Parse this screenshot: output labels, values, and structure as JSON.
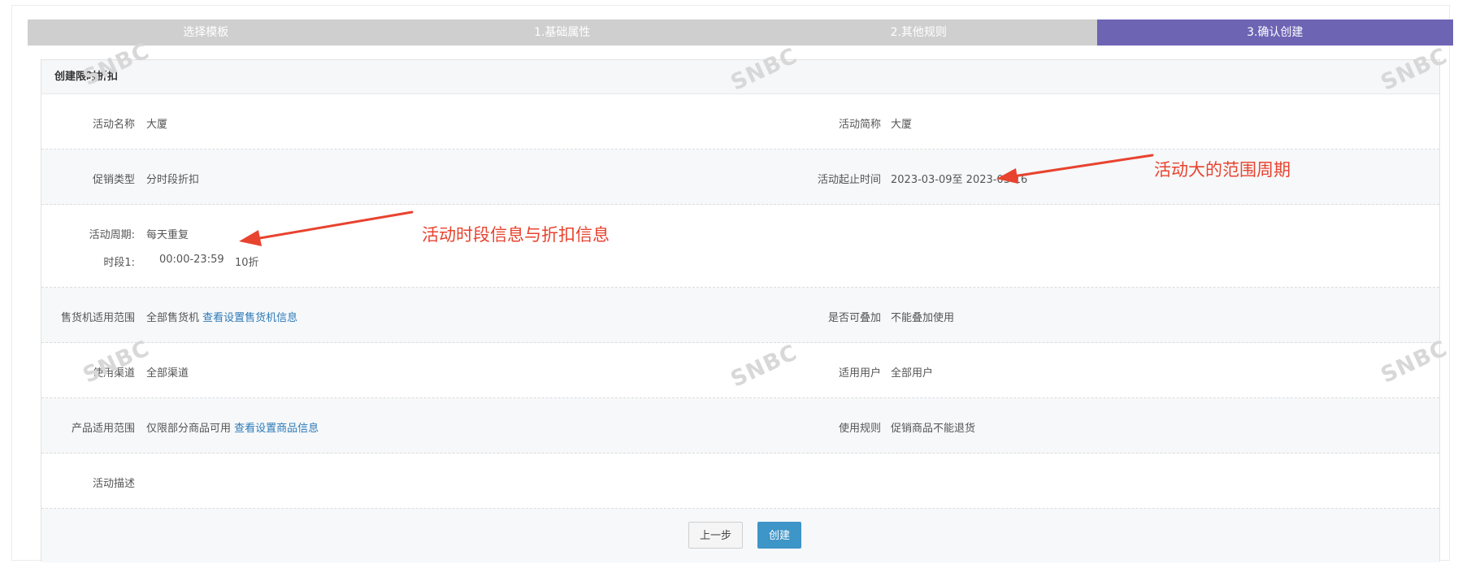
{
  "steps": [
    {
      "label": "选择模板",
      "active": false
    },
    {
      "label": "1.基础属性",
      "active": false
    },
    {
      "label": "2.其他规则",
      "active": false
    },
    {
      "label": "3.确认创建",
      "active": true
    }
  ],
  "panel": {
    "title": "创建限时折扣",
    "rows": {
      "activity_name": {
        "label": "活动名称",
        "value": "大厦"
      },
      "activity_short_name": {
        "label": "活动简称",
        "value": "大厦"
      },
      "promotion_type": {
        "label": "促销类型",
        "value": "分时段折扣"
      },
      "activity_time": {
        "label": "活动起止时间",
        "value": "2023-03-09至 2023-03-16"
      },
      "activity_cycle": {
        "label": "活动周期:",
        "value": "每天重复"
      },
      "period1": {
        "label": "时段1:",
        "time": "00:00-23:59",
        "discount": "10折"
      },
      "vending_scope": {
        "label": "售货机适用范围",
        "value": "全部售货机",
        "link": "查看设置售货机信息"
      },
      "stackable": {
        "label": "是否可叠加",
        "value": "不能叠加使用"
      },
      "channel": {
        "label": "使用渠道",
        "value": "全部渠道"
      },
      "users": {
        "label": "适用用户",
        "value": "全部用户"
      },
      "product_scope": {
        "label": "产品适用范围",
        "value": "仅限部分商品可用",
        "link": "查看设置商品信息"
      },
      "usage_rule": {
        "label": "使用规则",
        "value": "促销商品不能退货"
      },
      "description": {
        "label": "活动描述",
        "value": ""
      }
    }
  },
  "buttons": {
    "prev": "上一步",
    "create": "创建"
  },
  "annotations": {
    "range": "活动大的范围周期",
    "period": "活动时段信息与折扣信息",
    "color": "#e8432f"
  },
  "watermark": "SNBC",
  "colors": {
    "active_step": "#6d64b4",
    "inactive_step": "#cfcfcf",
    "primary_button": "#3e95c7",
    "link": "#2d7ab8"
  }
}
